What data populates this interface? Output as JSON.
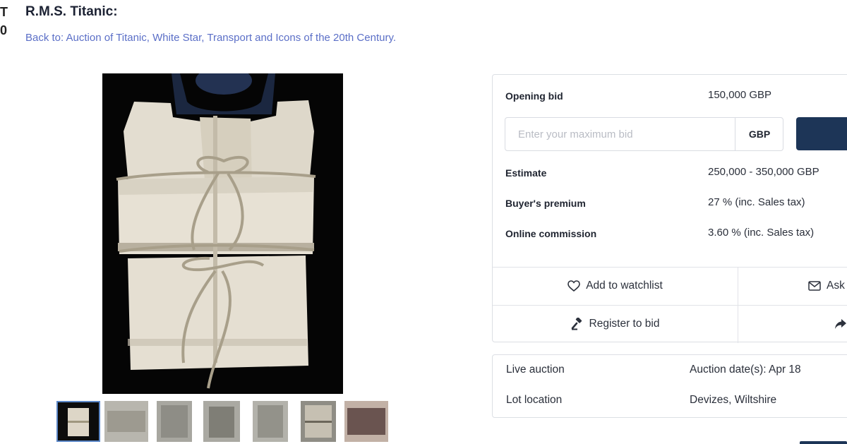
{
  "page": {
    "edge_text": "T\n0",
    "title": "R.M.S. Titanic:",
    "back_link": "Back to: Auction of Titanic, White Star, Transport and Icons of the 20th Century."
  },
  "gallery": {
    "main_image_alt": "",
    "thumbnail_count": 7,
    "active_thumbnail": 1
  },
  "bid_panel": {
    "opening_bid_label": "Opening bid",
    "opening_bid_value": "150,000  GBP",
    "bid_input_placeholder": "Enter your maximum bid",
    "currency": "GBP",
    "estimate_label": "Estimate",
    "estimate_value": "250,000 - 350,000 GBP",
    "buyers_premium_label": "Buyer's premium",
    "buyers_premium_value": "27 % (inc. Sales tax)",
    "online_commission_label": "Online commission",
    "online_commission_value": "3.60 % (inc. Sales tax)"
  },
  "actions": {
    "watchlist_label": "Add to watchlist",
    "ask_label": "Ask",
    "register_label": "Register to bid"
  },
  "info_panel": {
    "live_auction_label": "Live auction",
    "auction_dates": "Auction date(s): Apr 18",
    "lot_location_label": "Lot location",
    "lot_location_value": "Devizes, Wiltshire"
  },
  "colors": {
    "accent": "#1d3557",
    "link": "#5b6fc7",
    "border": "#dcdfe4"
  }
}
